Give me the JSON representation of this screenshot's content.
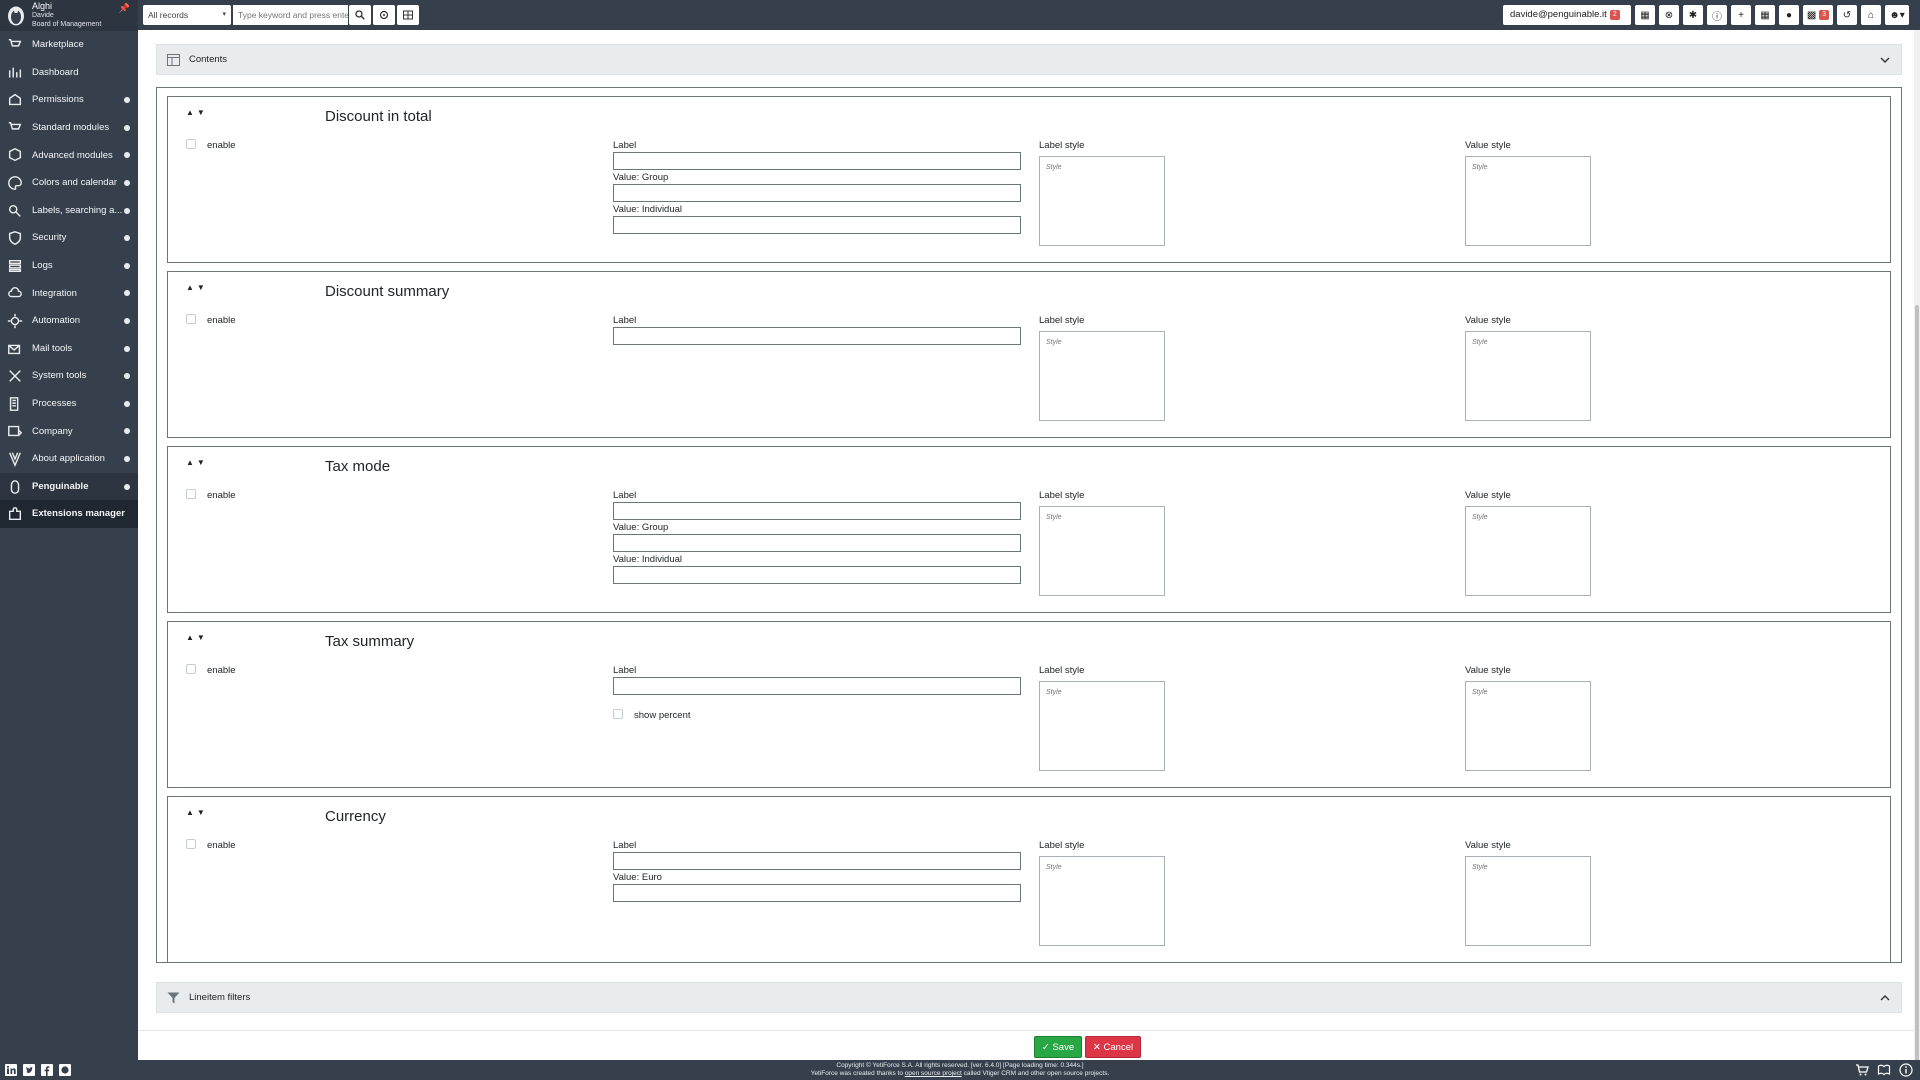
{
  "sidebar": {
    "company": "Alghi",
    "user": "Davide",
    "role": "Board of Management",
    "items": [
      {
        "label": "Marketplace",
        "icon": "cart-icon"
      },
      {
        "label": "Dashboard",
        "icon": "chart-icon"
      },
      {
        "label": "Permissions",
        "icon": "permissions-icon"
      },
      {
        "label": "Standard modules",
        "icon": "cart-modules-icon"
      },
      {
        "label": "Advanced modules",
        "icon": "cube-icon"
      },
      {
        "label": "Colors and calendar",
        "icon": "palette-icon"
      },
      {
        "label": "Labels, searching a...",
        "icon": "search-labels-icon"
      },
      {
        "label": "Security",
        "icon": "shield-icon"
      },
      {
        "label": "Logs",
        "icon": "logs-icon"
      },
      {
        "label": "Integration",
        "icon": "cloud-icon"
      },
      {
        "label": "Automation",
        "icon": "gears-icon"
      },
      {
        "label": "Mail tools",
        "icon": "mail-icon"
      },
      {
        "label": "System tools",
        "icon": "tools-icon"
      },
      {
        "label": "Processes",
        "icon": "processes-icon"
      },
      {
        "label": "Company",
        "icon": "company-icon"
      },
      {
        "label": "About application",
        "icon": "yeti-icon"
      },
      {
        "label": "Penguinable",
        "icon": "penguin-icon"
      },
      {
        "label": "Extensions manager",
        "icon": "extensions-icon"
      }
    ]
  },
  "topbar": {
    "records_select": "All records",
    "search_placeholder": "Type keyword and press enter",
    "user_email": "davide@penguinable.it",
    "email_badge": "2",
    "calendar_badge": "3"
  },
  "contents_block": {
    "title": "Contents"
  },
  "items": [
    {
      "title": "Discount in total",
      "enable_label": "enable",
      "fields": [
        "Label",
        "Value: Group",
        "Value: Individual"
      ],
      "label_style": "Label style",
      "value_style": "Value style",
      "style_placeholder": "Style"
    },
    {
      "title": "Discount summary",
      "enable_label": "enable",
      "fields": [
        "Label"
      ],
      "label_style": "Label style",
      "value_style": "Value style",
      "style_placeholder": "Style"
    },
    {
      "title": "Tax mode",
      "enable_label": "enable",
      "fields": [
        "Label",
        "Value: Group",
        "Value: Individual"
      ],
      "label_style": "Label style",
      "value_style": "Value style",
      "style_placeholder": "Style"
    },
    {
      "title": "Tax summary",
      "enable_label": "enable",
      "fields": [
        "Label"
      ],
      "show_percent": "show percent",
      "label_style": "Label style",
      "value_style": "Value style",
      "style_placeholder": "Style"
    },
    {
      "title": "Currency",
      "enable_label": "enable",
      "fields": [
        "Label",
        "Value: Euro"
      ],
      "label_style": "Label style",
      "value_style": "Value style",
      "style_placeholder": "Style"
    }
  ],
  "lineitem_block": {
    "title": "Lineitem filters"
  },
  "actions": {
    "save": "Save",
    "cancel": "Cancel"
  },
  "footer": {
    "copyright": "Copyright © YetiForce S.A. All rights reserved. [ver. 6.4.0] [Page loading time: 0.344s.]",
    "credits_pre": "YetiForce was created thanks to ",
    "credits_link": "open source project",
    "credits_post": " called Vtiger CRM and other open source projects."
  },
  "colors": {
    "sidebar": "#36404d",
    "save": "#28a745",
    "cancel": "#dc3545",
    "badge": "#d9534f"
  }
}
